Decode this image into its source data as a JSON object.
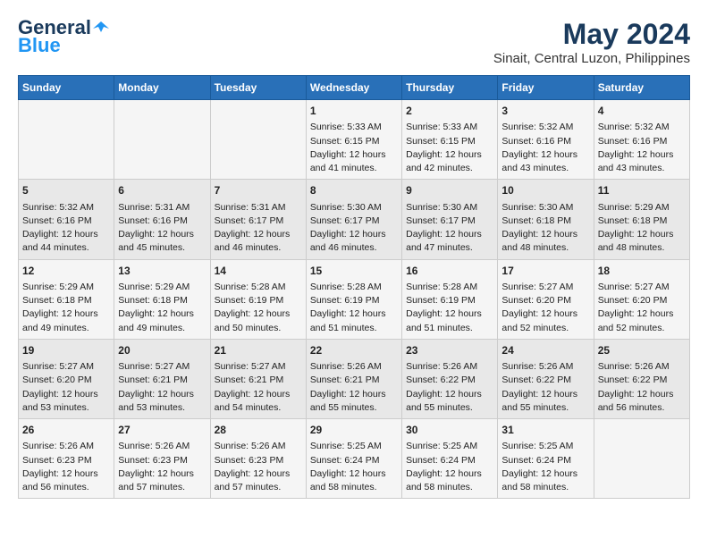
{
  "logo": {
    "general": "General",
    "blue": "Blue"
  },
  "title": {
    "month_year": "May 2024",
    "location": "Sinait, Central Luzon, Philippines"
  },
  "headers": [
    "Sunday",
    "Monday",
    "Tuesday",
    "Wednesday",
    "Thursday",
    "Friday",
    "Saturday"
  ],
  "weeks": [
    [
      {
        "day": "",
        "data": ""
      },
      {
        "day": "",
        "data": ""
      },
      {
        "day": "",
        "data": ""
      },
      {
        "day": "1",
        "data": "Sunrise: 5:33 AM\nSunset: 6:15 PM\nDaylight: 12 hours\nand 41 minutes."
      },
      {
        "day": "2",
        "data": "Sunrise: 5:33 AM\nSunset: 6:15 PM\nDaylight: 12 hours\nand 42 minutes."
      },
      {
        "day": "3",
        "data": "Sunrise: 5:32 AM\nSunset: 6:16 PM\nDaylight: 12 hours\nand 43 minutes."
      },
      {
        "day": "4",
        "data": "Sunrise: 5:32 AM\nSunset: 6:16 PM\nDaylight: 12 hours\nand 43 minutes."
      }
    ],
    [
      {
        "day": "5",
        "data": "Sunrise: 5:32 AM\nSunset: 6:16 PM\nDaylight: 12 hours\nand 44 minutes."
      },
      {
        "day": "6",
        "data": "Sunrise: 5:31 AM\nSunset: 6:16 PM\nDaylight: 12 hours\nand 45 minutes."
      },
      {
        "day": "7",
        "data": "Sunrise: 5:31 AM\nSunset: 6:17 PM\nDaylight: 12 hours\nand 46 minutes."
      },
      {
        "day": "8",
        "data": "Sunrise: 5:30 AM\nSunset: 6:17 PM\nDaylight: 12 hours\nand 46 minutes."
      },
      {
        "day": "9",
        "data": "Sunrise: 5:30 AM\nSunset: 6:17 PM\nDaylight: 12 hours\nand 47 minutes."
      },
      {
        "day": "10",
        "data": "Sunrise: 5:30 AM\nSunset: 6:18 PM\nDaylight: 12 hours\nand 48 minutes."
      },
      {
        "day": "11",
        "data": "Sunrise: 5:29 AM\nSunset: 6:18 PM\nDaylight: 12 hours\nand 48 minutes."
      }
    ],
    [
      {
        "day": "12",
        "data": "Sunrise: 5:29 AM\nSunset: 6:18 PM\nDaylight: 12 hours\nand 49 minutes."
      },
      {
        "day": "13",
        "data": "Sunrise: 5:29 AM\nSunset: 6:18 PM\nDaylight: 12 hours\nand 49 minutes."
      },
      {
        "day": "14",
        "data": "Sunrise: 5:28 AM\nSunset: 6:19 PM\nDaylight: 12 hours\nand 50 minutes."
      },
      {
        "day": "15",
        "data": "Sunrise: 5:28 AM\nSunset: 6:19 PM\nDaylight: 12 hours\nand 51 minutes."
      },
      {
        "day": "16",
        "data": "Sunrise: 5:28 AM\nSunset: 6:19 PM\nDaylight: 12 hours\nand 51 minutes."
      },
      {
        "day": "17",
        "data": "Sunrise: 5:27 AM\nSunset: 6:20 PM\nDaylight: 12 hours\nand 52 minutes."
      },
      {
        "day": "18",
        "data": "Sunrise: 5:27 AM\nSunset: 6:20 PM\nDaylight: 12 hours\nand 52 minutes."
      }
    ],
    [
      {
        "day": "19",
        "data": "Sunrise: 5:27 AM\nSunset: 6:20 PM\nDaylight: 12 hours\nand 53 minutes."
      },
      {
        "day": "20",
        "data": "Sunrise: 5:27 AM\nSunset: 6:21 PM\nDaylight: 12 hours\nand 53 minutes."
      },
      {
        "day": "21",
        "data": "Sunrise: 5:27 AM\nSunset: 6:21 PM\nDaylight: 12 hours\nand 54 minutes."
      },
      {
        "day": "22",
        "data": "Sunrise: 5:26 AM\nSunset: 6:21 PM\nDaylight: 12 hours\nand 55 minutes."
      },
      {
        "day": "23",
        "data": "Sunrise: 5:26 AM\nSunset: 6:22 PM\nDaylight: 12 hours\nand 55 minutes."
      },
      {
        "day": "24",
        "data": "Sunrise: 5:26 AM\nSunset: 6:22 PM\nDaylight: 12 hours\nand 55 minutes."
      },
      {
        "day": "25",
        "data": "Sunrise: 5:26 AM\nSunset: 6:22 PM\nDaylight: 12 hours\nand 56 minutes."
      }
    ],
    [
      {
        "day": "26",
        "data": "Sunrise: 5:26 AM\nSunset: 6:23 PM\nDaylight: 12 hours\nand 56 minutes."
      },
      {
        "day": "27",
        "data": "Sunrise: 5:26 AM\nSunset: 6:23 PM\nDaylight: 12 hours\nand 57 minutes."
      },
      {
        "day": "28",
        "data": "Sunrise: 5:26 AM\nSunset: 6:23 PM\nDaylight: 12 hours\nand 57 minutes."
      },
      {
        "day": "29",
        "data": "Sunrise: 5:25 AM\nSunset: 6:24 PM\nDaylight: 12 hours\nand 58 minutes."
      },
      {
        "day": "30",
        "data": "Sunrise: 5:25 AM\nSunset: 6:24 PM\nDaylight: 12 hours\nand 58 minutes."
      },
      {
        "day": "31",
        "data": "Sunrise: 5:25 AM\nSunset: 6:24 PM\nDaylight: 12 hours\nand 58 minutes."
      },
      {
        "day": "",
        "data": ""
      }
    ]
  ]
}
